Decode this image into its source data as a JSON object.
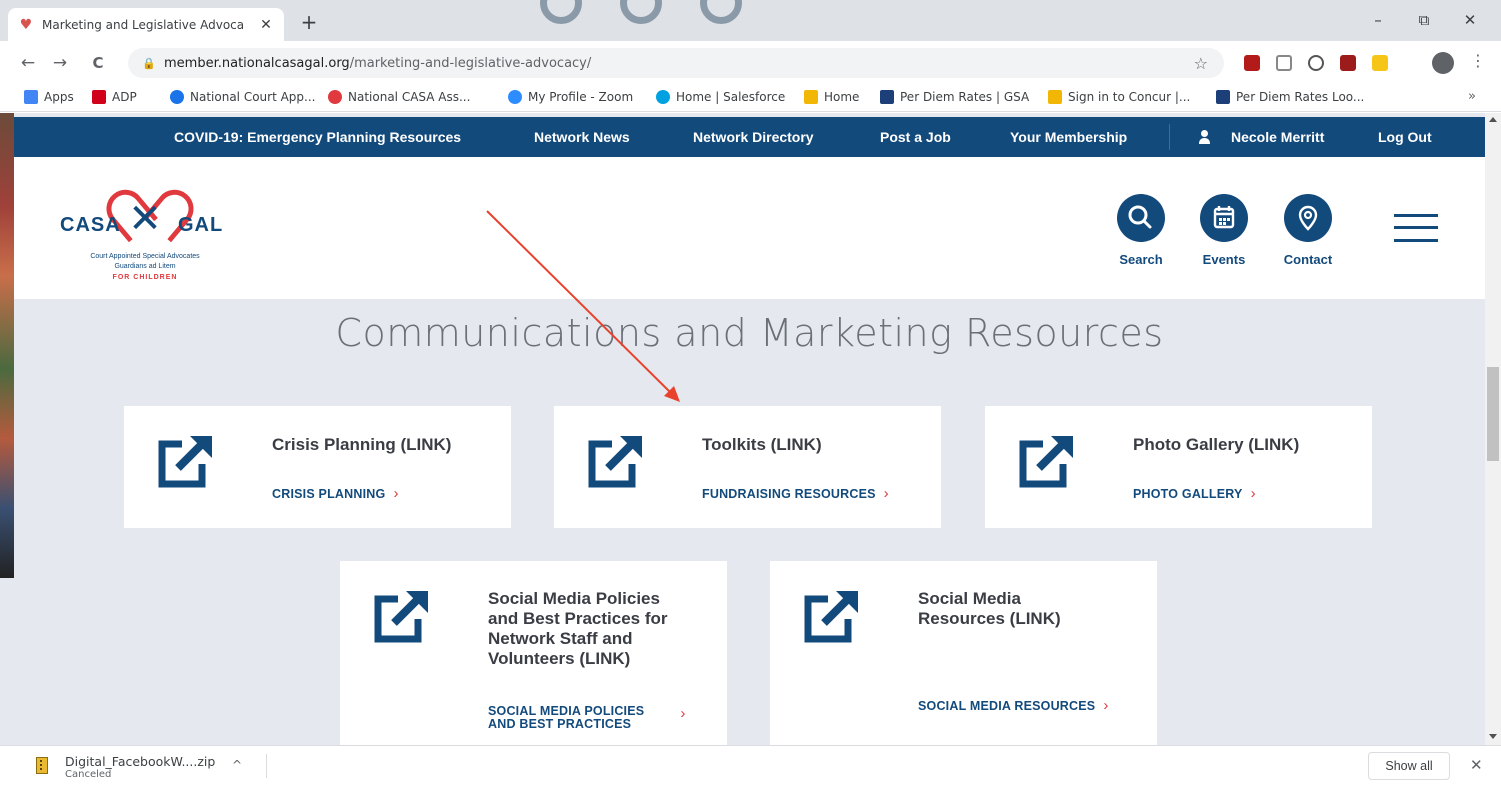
{
  "browser": {
    "tab_title": "Marketing and Legislative Advoca",
    "tab_close": "✕",
    "new_tab": "+",
    "window_minimize": "–",
    "window_restore": "⧉",
    "window_close": "✕",
    "url_host": "member.nationalcasagal.org",
    "url_path": "/marketing-and-legislative-advocacy/",
    "back": "←",
    "forward": "→",
    "reload": "C",
    "star": "☆"
  },
  "bookmarks": [
    {
      "label": "Apps",
      "icon": "apps-grid-icon",
      "color": "#4285f4"
    },
    {
      "label": "ADP",
      "icon": "adp-icon",
      "color": "#d0021b"
    },
    {
      "label": "National Court App...",
      "icon": "court-app-icon",
      "color": "#1a73e8"
    },
    {
      "label": "National CASA Ass...",
      "icon": "casa-icon",
      "color": "#e03a3e"
    },
    {
      "label": "My Profile - Zoom",
      "icon": "zoom-icon",
      "color": "#2d8cff"
    },
    {
      "label": "Home | Salesforce",
      "icon": "salesforce-icon",
      "color": "#00a1e0"
    },
    {
      "label": "Home",
      "icon": "concur-icon",
      "color": "#f2b705"
    },
    {
      "label": "Per Diem Rates | GSA",
      "icon": "gsa-icon",
      "color": "#1c3f7a"
    },
    {
      "label": "Sign in to Concur |...",
      "icon": "concur-icon",
      "color": "#f2b705"
    },
    {
      "label": "Per Diem Rates Loo...",
      "icon": "gsa-icon",
      "color": "#1c3f7a"
    }
  ],
  "bookmarks_more": "»",
  "topnav": {
    "covid": "COVID-19: Emergency Planning Resources",
    "news": "Network News",
    "directory": "Network Directory",
    "post_job": "Post a Job",
    "membership": "Your Membership",
    "user": "Necole Merritt",
    "logout": "Log Out"
  },
  "logo": {
    "left": "CASA",
    "right": "GAL",
    "line1": "Court Appointed Special Advocates",
    "line2": "Guardians ad Litem",
    "line3": "FOR CHILDREN"
  },
  "header_buttons": {
    "search": "Search",
    "events": "Events",
    "contact": "Contact"
  },
  "page_title": "Communications and Marketing Resources",
  "cards": [
    {
      "title": "Crisis Planning (LINK)",
      "link": "CRISIS PLANNING"
    },
    {
      "title": "Toolkits (LINK)",
      "link": "FUNDRAISING RESOURCES"
    },
    {
      "title": "Photo Gallery (LINK)",
      "link": "PHOTO GALLERY"
    },
    {
      "title_lines": [
        "Social Media Policies",
        "and Best Practices for",
        "Network Staff and",
        "Volunteers (LINK)"
      ],
      "link_lines": [
        "SOCIAL MEDIA POLICIES",
        "AND BEST PRACTICES"
      ]
    },
    {
      "title_lines": [
        "Social Media",
        "Resources (LINK)"
      ],
      "link": "SOCIAL MEDIA RESOURCES"
    }
  ],
  "chevron": "›",
  "download": {
    "filename": "Digital_FacebookW....zip",
    "status": "Canceled",
    "caret": "^",
    "show_all": "Show all",
    "close": "✕"
  },
  "colors": {
    "brand_navy": "#134a7c",
    "accent_red": "#e03a3e",
    "annotation_arrow": "#e8412c"
  }
}
